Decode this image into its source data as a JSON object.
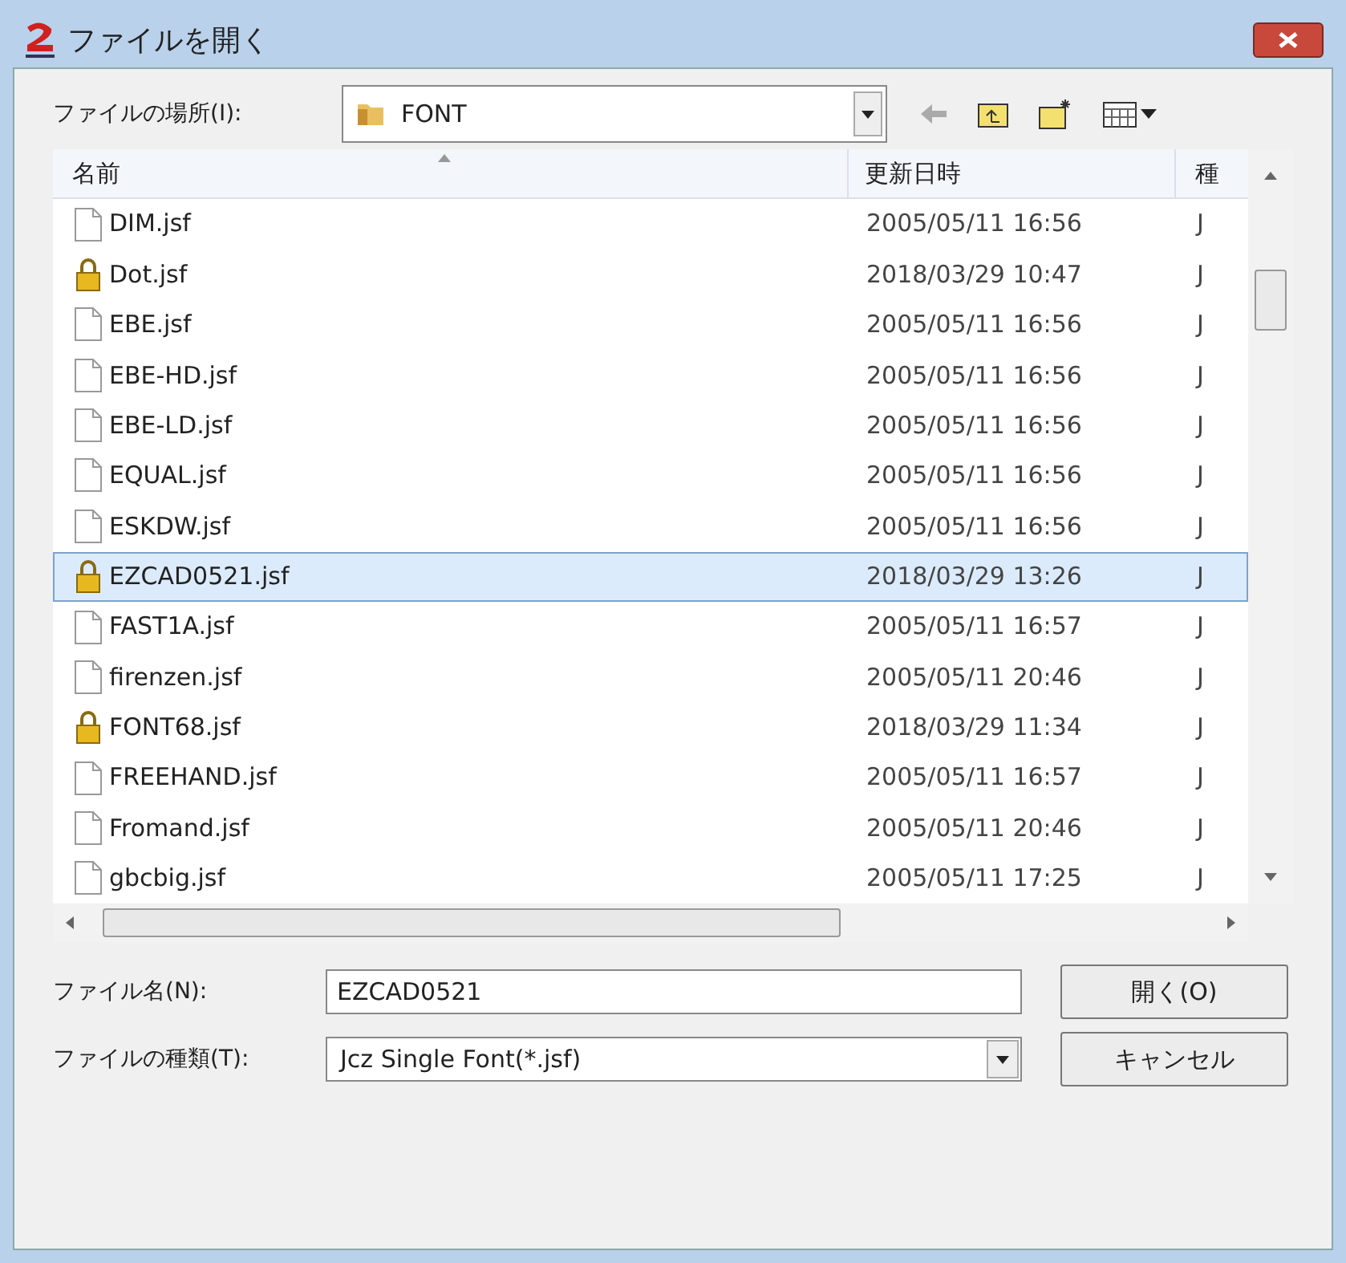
{
  "window": {
    "title": "ファイルを開く"
  },
  "location": {
    "label": "ファイルの場所(I):",
    "value": "FONT"
  },
  "columns": [
    "名前",
    "更新日時",
    "種"
  ],
  "rows": [
    {
      "name": "DIM.jsf",
      "date": "2005/05/11 16:56",
      "type": "J",
      "locked": false,
      "selected": false
    },
    {
      "name": "Dot.jsf",
      "date": "2018/03/29 10:47",
      "type": "J",
      "locked": true,
      "selected": false
    },
    {
      "name": "EBE.jsf",
      "date": "2005/05/11 16:56",
      "type": "J",
      "locked": false,
      "selected": false
    },
    {
      "name": "EBE-HD.jsf",
      "date": "2005/05/11 16:56",
      "type": "J",
      "locked": false,
      "selected": false
    },
    {
      "name": "EBE-LD.jsf",
      "date": "2005/05/11 16:56",
      "type": "J",
      "locked": false,
      "selected": false
    },
    {
      "name": "EQUAL.jsf",
      "date": "2005/05/11 16:56",
      "type": "J",
      "locked": false,
      "selected": false
    },
    {
      "name": "ESKDW.jsf",
      "date": "2005/05/11 16:56",
      "type": "J",
      "locked": false,
      "selected": false
    },
    {
      "name": "EZCAD0521.jsf",
      "date": "2018/03/29 13:26",
      "type": "J",
      "locked": true,
      "selected": true
    },
    {
      "name": "FAST1A.jsf",
      "date": "2005/05/11 16:57",
      "type": "J",
      "locked": false,
      "selected": false
    },
    {
      "name": "firenzen.jsf",
      "date": "2005/05/11 20:46",
      "type": "J",
      "locked": false,
      "selected": false
    },
    {
      "name": "FONT68.jsf",
      "date": "2018/03/29 11:34",
      "type": "J",
      "locked": true,
      "selected": false
    },
    {
      "name": "FREEHAND.jsf",
      "date": "2005/05/11 16:57",
      "type": "J",
      "locked": false,
      "selected": false
    },
    {
      "name": "Fromand.jsf",
      "date": "2005/05/11 20:46",
      "type": "J",
      "locked": false,
      "selected": false
    },
    {
      "name": "gbcbig.jsf",
      "date": "2005/05/11 17:25",
      "type": "J",
      "locked": false,
      "selected": false
    }
  ],
  "filename": {
    "label": "ファイル名(N):",
    "value": "EZCAD0521"
  },
  "filetype": {
    "label": "ファイルの種類(T):",
    "value": "Jcz Single Font(*.jsf)"
  },
  "buttons": [
    "開く(O)",
    "キャンセル"
  ]
}
